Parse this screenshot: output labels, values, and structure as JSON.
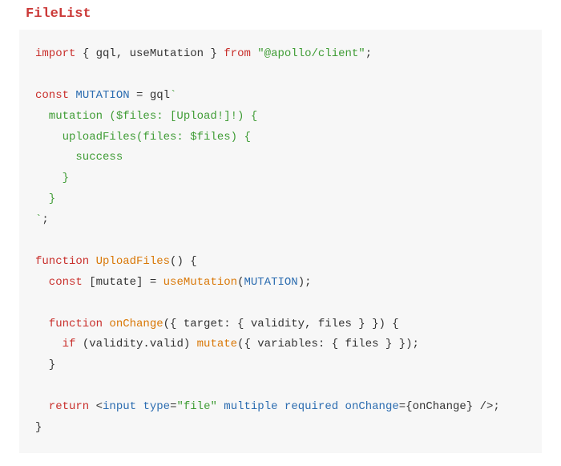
{
  "heading": "FileList",
  "code": {
    "l1_import": "import",
    "l1_braces": " { gql, useMutation } ",
    "l1_from": "from",
    "l1_str": "\"@apollo/client\"",
    "l1_semi": ";",
    "l3_const": "const",
    "l3_name": " MUTATION ",
    "l3_eq": "= gql",
    "l3_tick": "`",
    "l4": "  mutation ($files: [Upload!]!) {",
    "l5": "    uploadFiles(files: $files) {",
    "l6": "      success",
    "l7": "    }",
    "l8": "  }",
    "l9_tick": "`",
    "l9_semi": ";",
    "l11_function": "function",
    "l11_name": " UploadFiles",
    "l11_rest": "() {",
    "l12_const": "  const",
    "l12_mid": " [mutate] = ",
    "l12_fn": "useMutation",
    "l12_open": "(",
    "l12_arg": "MUTATION",
    "l12_close": ");",
    "l14_function": "  function",
    "l14_name": " onChange",
    "l14_rest": "({ target: { validity, files } }) {",
    "l15_if": "    if",
    "l15_mid": " (validity.valid) ",
    "l15_fn": "mutate",
    "l15_rest": "({ variables: { files } });",
    "l16": "  }",
    "l18_return": "  return",
    "l18_sp": " ",
    "l18_open": "<",
    "l18_tag": "input",
    "l18_sp2": " ",
    "l18_a1": "type",
    "l18_eq1": "=",
    "l18_v1": "\"file\"",
    "l18_sp3": " ",
    "l18_a2": "multiple",
    "l18_sp4": " ",
    "l18_a3": "required",
    "l18_sp5": " ",
    "l18_a4": "onChange",
    "l18_eq2": "=",
    "l18_ob": "{onChange}",
    "l18_close": " />",
    "l18_semi": ";",
    "l19": "}"
  }
}
